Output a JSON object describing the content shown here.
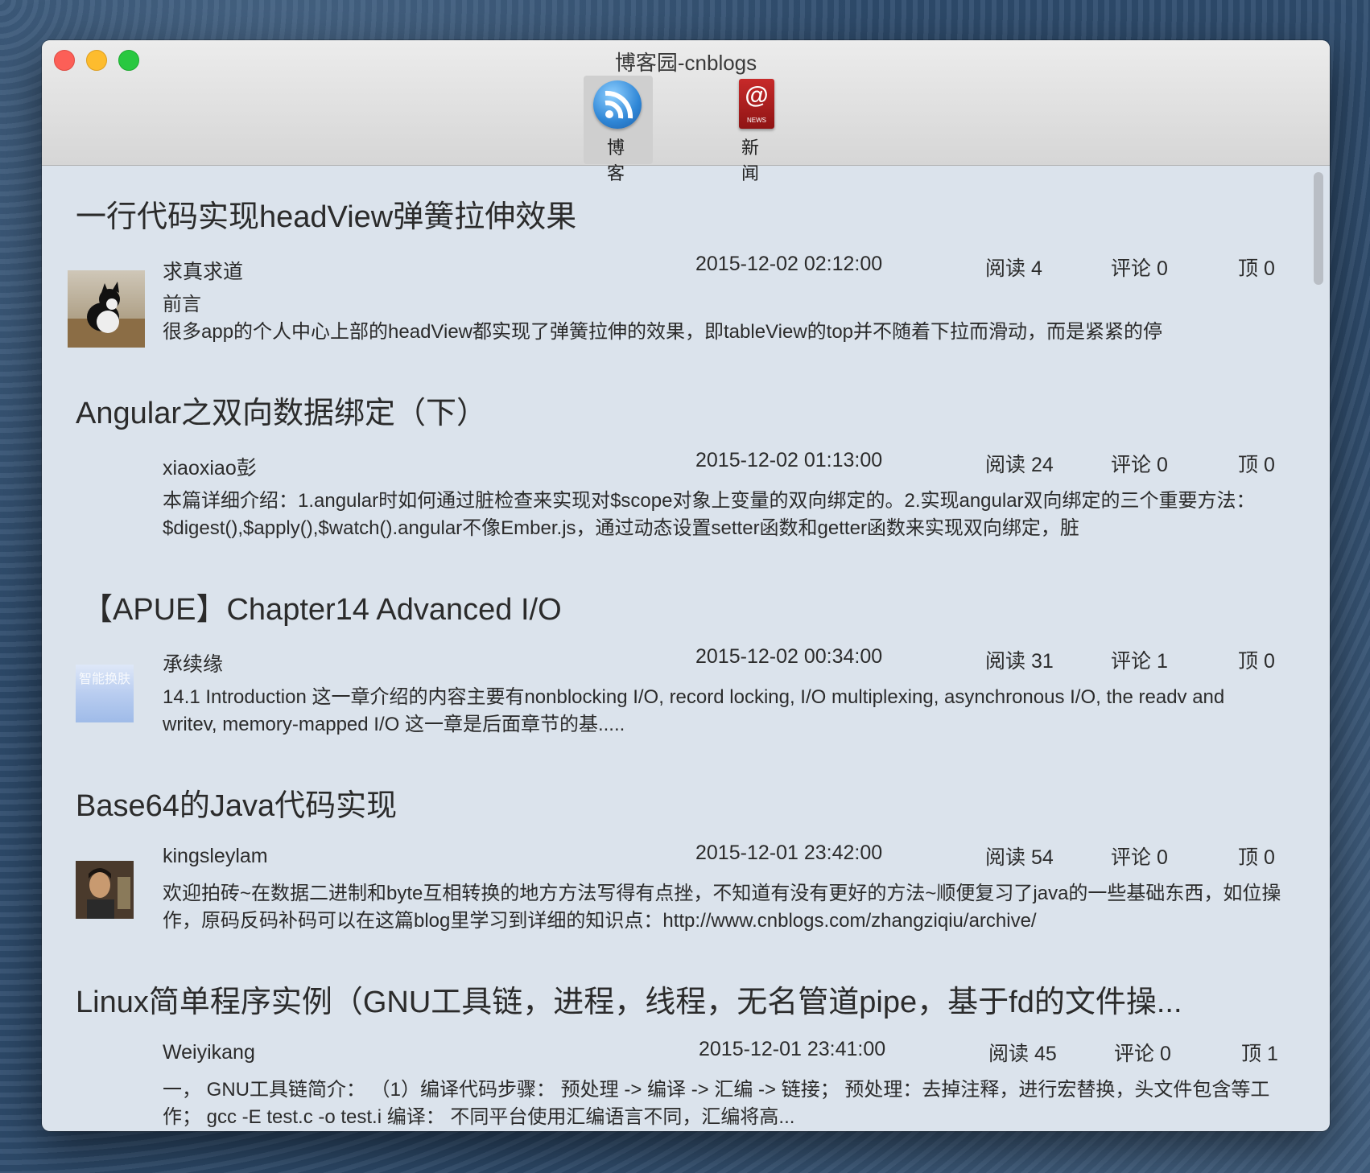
{
  "window": {
    "title": "博客园-cnblogs"
  },
  "toolbar": {
    "blog_label": "博客",
    "news_label": "新闻",
    "news_icon_text": "NEWS"
  },
  "posts": [
    {
      "title": "一行代码实现headView弹簧拉伸效果",
      "author": "求真求道",
      "date": "2015-12-02 02:12:00",
      "reads": "阅读 4",
      "comments": "评论 0",
      "top": "顶 0",
      "lead": "前言",
      "summary": "很多app的个人中心上部的headView都实现了弹簧拉伸的效果，即tableView的top并不随着下拉而滑动，而是紧紧的停"
    },
    {
      "title": "Angular之双向数据绑定（下）",
      "author": "xiaoxiao彭",
      "date": "2015-12-02 01:13:00",
      "reads": "阅读 24",
      "comments": "评论 0",
      "top": "顶 0",
      "summary": "本篇详细介绍：1.angular时如何通过脏检查来实现对$scope对象上变量的双向绑定的。2.实现angular双向绑定的三个重要方法：$digest(),$apply(),$watch().angular不像Ember.js，通过动态设置setter函数和getter函数来实现双向绑定，脏"
    },
    {
      "title": "【APUE】Chapter14 Advanced I/O",
      "author": "承续缘",
      "date": "2015-12-02 00:34:00",
      "reads": "阅读 31",
      "comments": "评论 1",
      "top": "顶 0",
      "avatar_text": "智能换肤",
      "summary": "14.1 Introduction 这一章介绍的内容主要有nonblocking I/O, record locking, I/O multiplexing, asynchronous I/O, the readv and writev, memory-mapped I/O 这一章是后面章节的基....."
    },
    {
      "title": "Base64的Java代码实现",
      "author": "kingsleylam",
      "date": "2015-12-01 23:42:00",
      "reads": "阅读 54",
      "comments": "评论 0",
      "top": "顶 0",
      "summary": "欢迎拍砖~在数据二进制和byte互相转换的地方方法写得有点挫，不知道有没有更好的方法~顺便复习了java的一些基础东西，如位操作，原码反码补码可以在这篇blog里学习到详细的知识点：http://www.cnblogs.com/zhangziqiu/archive/"
    },
    {
      "title": "Linux简单程序实例（GNU工具链，进程，线程，无名管道pipe，基于fd的文件操...",
      "author": "Weiyikang",
      "date": "2015-12-01 23:41:00",
      "reads": "阅读 45",
      "comments": "评论 0",
      "top": "顶 1",
      "summary": "一，  GNU工具链简介：  （1）编译代码步骤：  预处理 -> 编译 -> 汇编 -> 链接；  预处理：去掉注释，进行宏替换，头文件包含等工作；  gcc -E test.c -o test.i 编译：  不同平台使用汇编语言不同，汇编将高..."
    }
  ]
}
